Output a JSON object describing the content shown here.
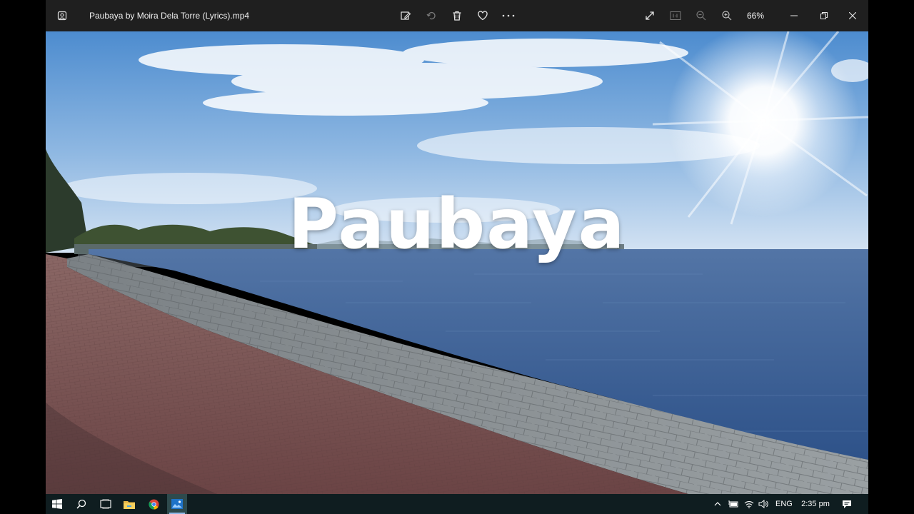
{
  "titlebar": {
    "file_name": "Paubaya by Moira Dela Torre (Lyrics).mp4",
    "zoom_level": "66%",
    "background_color": "#1f1f1f",
    "icons": [
      "photos-app-icon",
      "edit-create-icon",
      "rotate-icon",
      "delete-icon",
      "heart-icon",
      "more-icon",
      "fullscreen-icon",
      "actual-size-icon",
      "zoom-out-icon",
      "zoom-in-icon",
      "minimize-icon",
      "restore-icon",
      "close-icon"
    ]
  },
  "video": {
    "overlay_text": "Paubaya",
    "scene": "seaside promenade with stone seawall, blue sea and bright sun",
    "colors": {
      "sky_top": "#4f8fd0",
      "sky_bottom": "#cfe0f2",
      "sea": "#3a5f97",
      "walkway": "#7a5553",
      "wall": "#8a8f93"
    }
  },
  "taskbar": {
    "background_color": "#0f1d20",
    "apps": [
      "windows-start-icon",
      "search-icon",
      "task-view-icon",
      "file-explorer-icon",
      "chrome-icon",
      "photos-icon"
    ],
    "tray": {
      "language": "ENG",
      "time": "2:35 pm",
      "icons": [
        "chevron-up-icon",
        "battery-icon",
        "wifi-icon",
        "volume-icon",
        "notification-icon"
      ]
    }
  }
}
